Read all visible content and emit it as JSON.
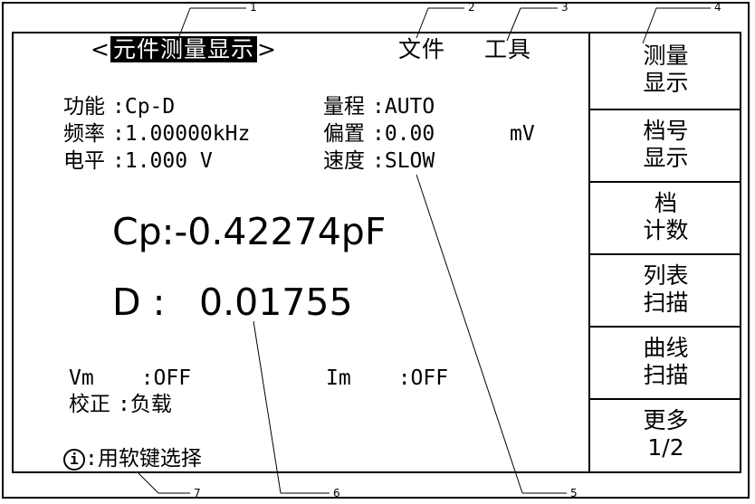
{
  "header": {
    "left_bracket": "<",
    "active_tab": "元件测量显示",
    "right_bracket": ">",
    "file_menu": "文件",
    "tools_menu": "工具"
  },
  "params": {
    "function_label": "功能",
    "function_value": ":Cp-D",
    "frequency_label": "频率",
    "frequency_value": ":1.00000kHz",
    "level_label": "电平",
    "level_value": ":1.000 V",
    "range_label": "量程",
    "range_value": ":AUTO",
    "bias_label": "偏置",
    "bias_value": ":0.00",
    "bias_unit": "mV",
    "speed_label": "速度",
    "speed_value": ":SLOW"
  },
  "readout": {
    "primary": "Cp:-0.42274pF",
    "secondary_label": "D :",
    "secondary_value": "0.01755"
  },
  "monitor": {
    "vm_label": "Vm",
    "vm_value": ":OFF",
    "im_label": "Im",
    "im_value": ":OFF",
    "correction_label": "校正",
    "correction_value": ":负载"
  },
  "status": {
    "info_glyph": "i",
    "hint": ":用软键选择"
  },
  "softkeys": [
    {
      "line1": "测量",
      "line2": "显示"
    },
    {
      "line1": "档号",
      "line2": "显示"
    },
    {
      "line1": "档",
      "line2": "计数"
    },
    {
      "line1": "列表",
      "line2": "扫描"
    },
    {
      "line1": "曲线",
      "line2": "扫描"
    },
    {
      "line1": "更多",
      "line2": "1/2"
    }
  ],
  "callouts": [
    "1",
    "2",
    "3",
    "4",
    "5",
    "6",
    "7"
  ]
}
